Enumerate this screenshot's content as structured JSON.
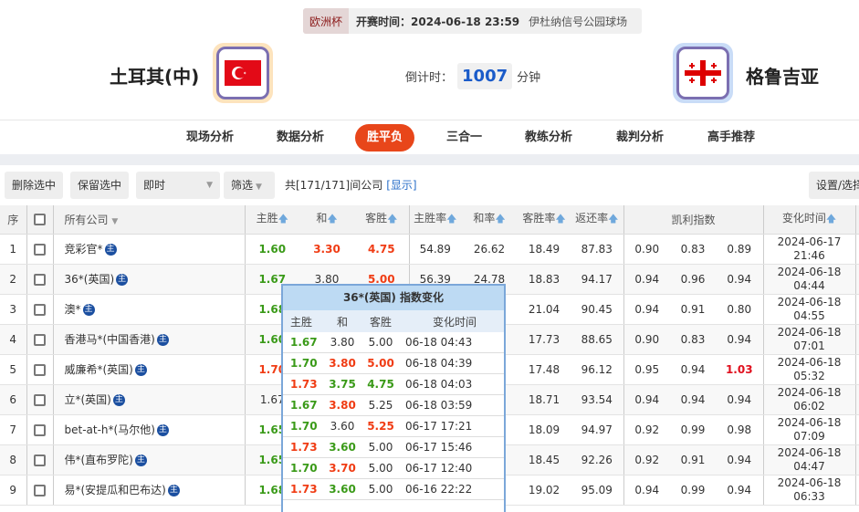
{
  "match": {
    "league": "欧洲杯",
    "kickoff_label": "开赛时间：2024-06-18 23:59",
    "venue": "伊杜纳信号公园球场",
    "home": "土耳其(中)",
    "away": "格鲁吉亚",
    "countdown_label": "倒计时：",
    "countdown_value": "1007",
    "countdown_unit": "分钟",
    "home_flag": "turkey-flag",
    "away_flag": "georgia-flag"
  },
  "nav": {
    "tabs": [
      "现场分析",
      "数据分析",
      "胜平负",
      "三合一",
      "教练分析",
      "裁判分析",
      "高手推荐"
    ],
    "active": "胜平负"
  },
  "toolbar": {
    "delete": "删除选中",
    "keep": "保留选中",
    "mode": "即时",
    "filter": "筛选",
    "count_text": "共[171/171]间公司",
    "show_link": "[显示]",
    "settings": "设置/选择"
  },
  "table": {
    "headers": [
      "序",
      "",
      "所有公司",
      "主胜",
      "和",
      "客胜",
      "主胜率",
      "和率",
      "客胜率",
      "返还率",
      "凯利指数",
      "变化时间"
    ],
    "rows": [
      {
        "no": "1",
        "company": "竞彩官*",
        "home": "1.60",
        "hc": "g",
        "draw": "3.30",
        "dc": "r",
        "away": "4.75",
        "ac": "r",
        "hr": "54.89",
        "dr": "26.62",
        "ar": "18.49",
        "ret": "87.83",
        "k1": "0.90",
        "k2": "0.83",
        "k3": "0.89",
        "k3c": "",
        "d": "2024-06-17",
        "t": "21:46"
      },
      {
        "no": "2",
        "company": "36*(英国)",
        "home": "1.67",
        "hc": "g",
        "draw": "3.80",
        "dc": "",
        "away": "5.00",
        "ac": "r",
        "hr": "56.39",
        "dr": "24.78",
        "ar": "18.83",
        "ret": "94.17",
        "k1": "0.94",
        "k2": "0.96",
        "k3": "0.94",
        "k3c": "",
        "d": "2024-06-18",
        "t": "04:44"
      },
      {
        "no": "3",
        "company": "澳*",
        "home": "1.68",
        "hc": "g",
        "ar": "21.04",
        "ret": "90.45",
        "k1": "0.94",
        "k2": "0.91",
        "k3": "0.80",
        "k3c": "",
        "d": "2024-06-18",
        "t": "04:55"
      },
      {
        "no": "4",
        "company": "香港马*(中国香港)",
        "home": "1.60",
        "hc": "g",
        "ar": "17.73",
        "ret": "88.65",
        "k1": "0.90",
        "k2": "0.83",
        "k3": "0.94",
        "k3c": "",
        "d": "2024-06-18",
        "t": "07:01"
      },
      {
        "no": "5",
        "company": "威廉希*(英国)",
        "home": "1.70",
        "hc": "r",
        "ar": "17.48",
        "ret": "96.12",
        "k1": "0.95",
        "k2": "0.94",
        "k3": "1.03",
        "k3c": "rr",
        "d": "2024-06-18",
        "t": "05:32"
      },
      {
        "no": "6",
        "company": "立*(英国)",
        "home": "1.67",
        "hc": "",
        "ar": "18.71",
        "ret": "93.54",
        "k1": "0.94",
        "k2": "0.94",
        "k3": "0.94",
        "k3c": "",
        "d": "2024-06-18",
        "t": "06:02"
      },
      {
        "no": "7",
        "company": "bet-at-h*(马尔他)",
        "home": "1.65",
        "hc": "g",
        "ar": "18.09",
        "ret": "94.97",
        "k1": "0.92",
        "k2": "0.99",
        "k3": "0.98",
        "k3c": "",
        "d": "2024-06-18",
        "t": "07:09"
      },
      {
        "no": "8",
        "company": "伟*(直布罗陀)",
        "home": "1.65",
        "hc": "g",
        "ar": "18.45",
        "ret": "92.26",
        "k1": "0.92",
        "k2": "0.91",
        "k3": "0.94",
        "k3c": "",
        "d": "2024-06-18",
        "t": "04:47"
      },
      {
        "no": "9",
        "company": "易*(安提瓜和巴布达)",
        "home": "1.68",
        "hc": "g",
        "ar": "19.02",
        "ret": "95.09",
        "k1": "0.94",
        "k2": "0.99",
        "k3": "0.94",
        "k3c": "",
        "d": "2024-06-18",
        "t": "06:33"
      }
    ],
    "badge": "主"
  },
  "popup": {
    "title": "36*(英国) 指数变化",
    "headers": [
      "主胜",
      "和",
      "客胜",
      "变化时间"
    ],
    "rows": [
      {
        "h": "1.67",
        "hc": "g",
        "d": "3.80",
        "dc": "",
        "a": "5.00",
        "ac": "",
        "t": "06-18 04:43"
      },
      {
        "h": "1.70",
        "hc": "g",
        "d": "3.80",
        "dc": "r",
        "a": "5.00",
        "ac": "r",
        "t": "06-18 04:39"
      },
      {
        "h": "1.73",
        "hc": "r",
        "d": "3.75",
        "dc": "g",
        "a": "4.75",
        "ac": "g",
        "t": "06-18 04:03"
      },
      {
        "h": "1.67",
        "hc": "g",
        "d": "3.80",
        "dc": "r",
        "a": "5.25",
        "ac": "",
        "t": "06-18 03:59"
      },
      {
        "h": "1.70",
        "hc": "g",
        "d": "3.60",
        "dc": "",
        "a": "5.25",
        "ac": "r",
        "t": "06-17 17:21"
      },
      {
        "h": "1.73",
        "hc": "r",
        "d": "3.60",
        "dc": "g",
        "a": "5.00",
        "ac": "",
        "t": "06-17 15:46"
      },
      {
        "h": "1.70",
        "hc": "g",
        "d": "3.70",
        "dc": "r",
        "a": "5.00",
        "ac": "",
        "t": "06-17 12:40"
      },
      {
        "h": "1.73",
        "hc": "r",
        "d": "3.60",
        "dc": "g",
        "a": "5.00",
        "ac": "",
        "t": "06-16 22:22"
      }
    ]
  }
}
